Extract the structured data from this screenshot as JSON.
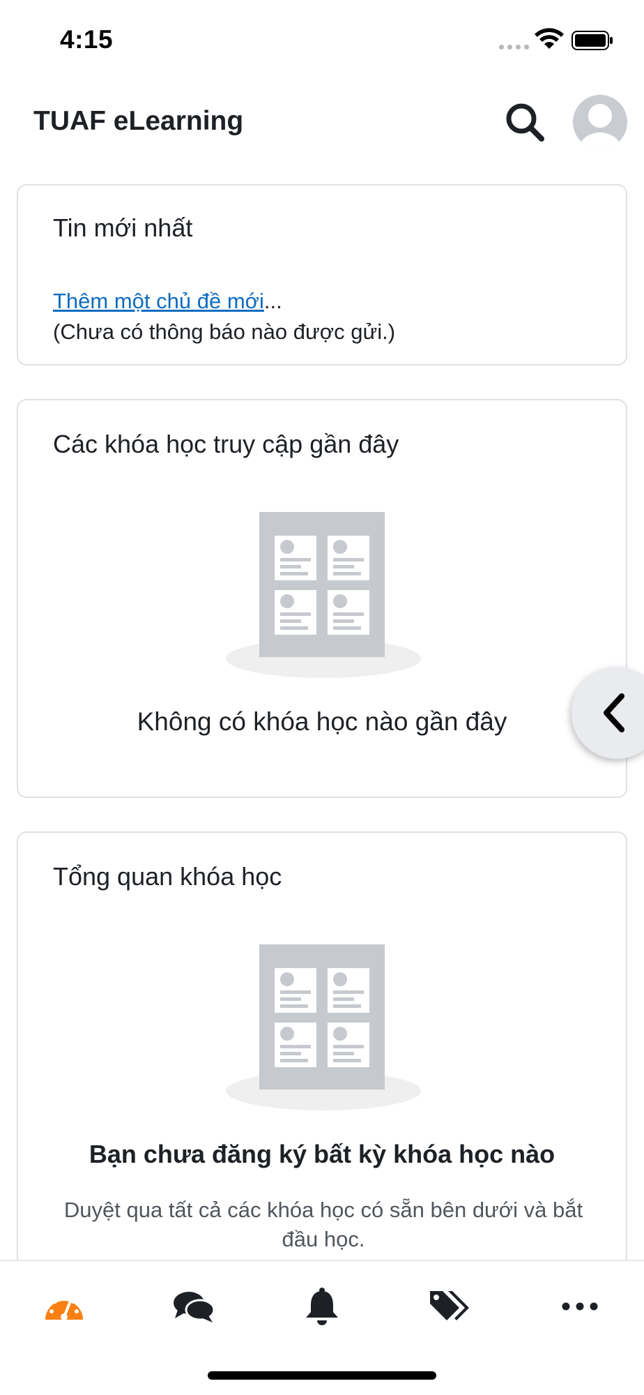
{
  "status_bar": {
    "time": "4:15"
  },
  "header": {
    "title": "TUAF eLearning"
  },
  "news": {
    "title": "Tin mới nhất",
    "link": "Thêm một chủ đề mới",
    "ellipsis": "...",
    "note": "(Chưa có thông báo nào được gửi.)"
  },
  "recent_courses": {
    "title": "Các khóa học truy cập gần đây",
    "empty_text": "Không có khóa học nào gần đây"
  },
  "overview": {
    "title": "Tổng quan khóa học",
    "empty_heading": "Bạn chưa đăng ký bất kỳ khóa học nào",
    "empty_desc": "Duyệt qua tất cả các khóa học có sẵn bên dưới và bắt đầu học."
  },
  "tabs": [
    {
      "name": "dashboard",
      "icon": "dashboard-gauge-icon",
      "active": true
    },
    {
      "name": "messages",
      "icon": "chat-bubbles-icon"
    },
    {
      "name": "notifications",
      "icon": "bell-icon"
    },
    {
      "name": "tags",
      "icon": "tags-icon"
    },
    {
      "name": "more",
      "icon": "ellipsis-icon"
    }
  ],
  "colors": {
    "accent": "#f98012",
    "link": "#0f6cbf",
    "illustration": "#c6c9cd",
    "text": "#1d2125"
  }
}
